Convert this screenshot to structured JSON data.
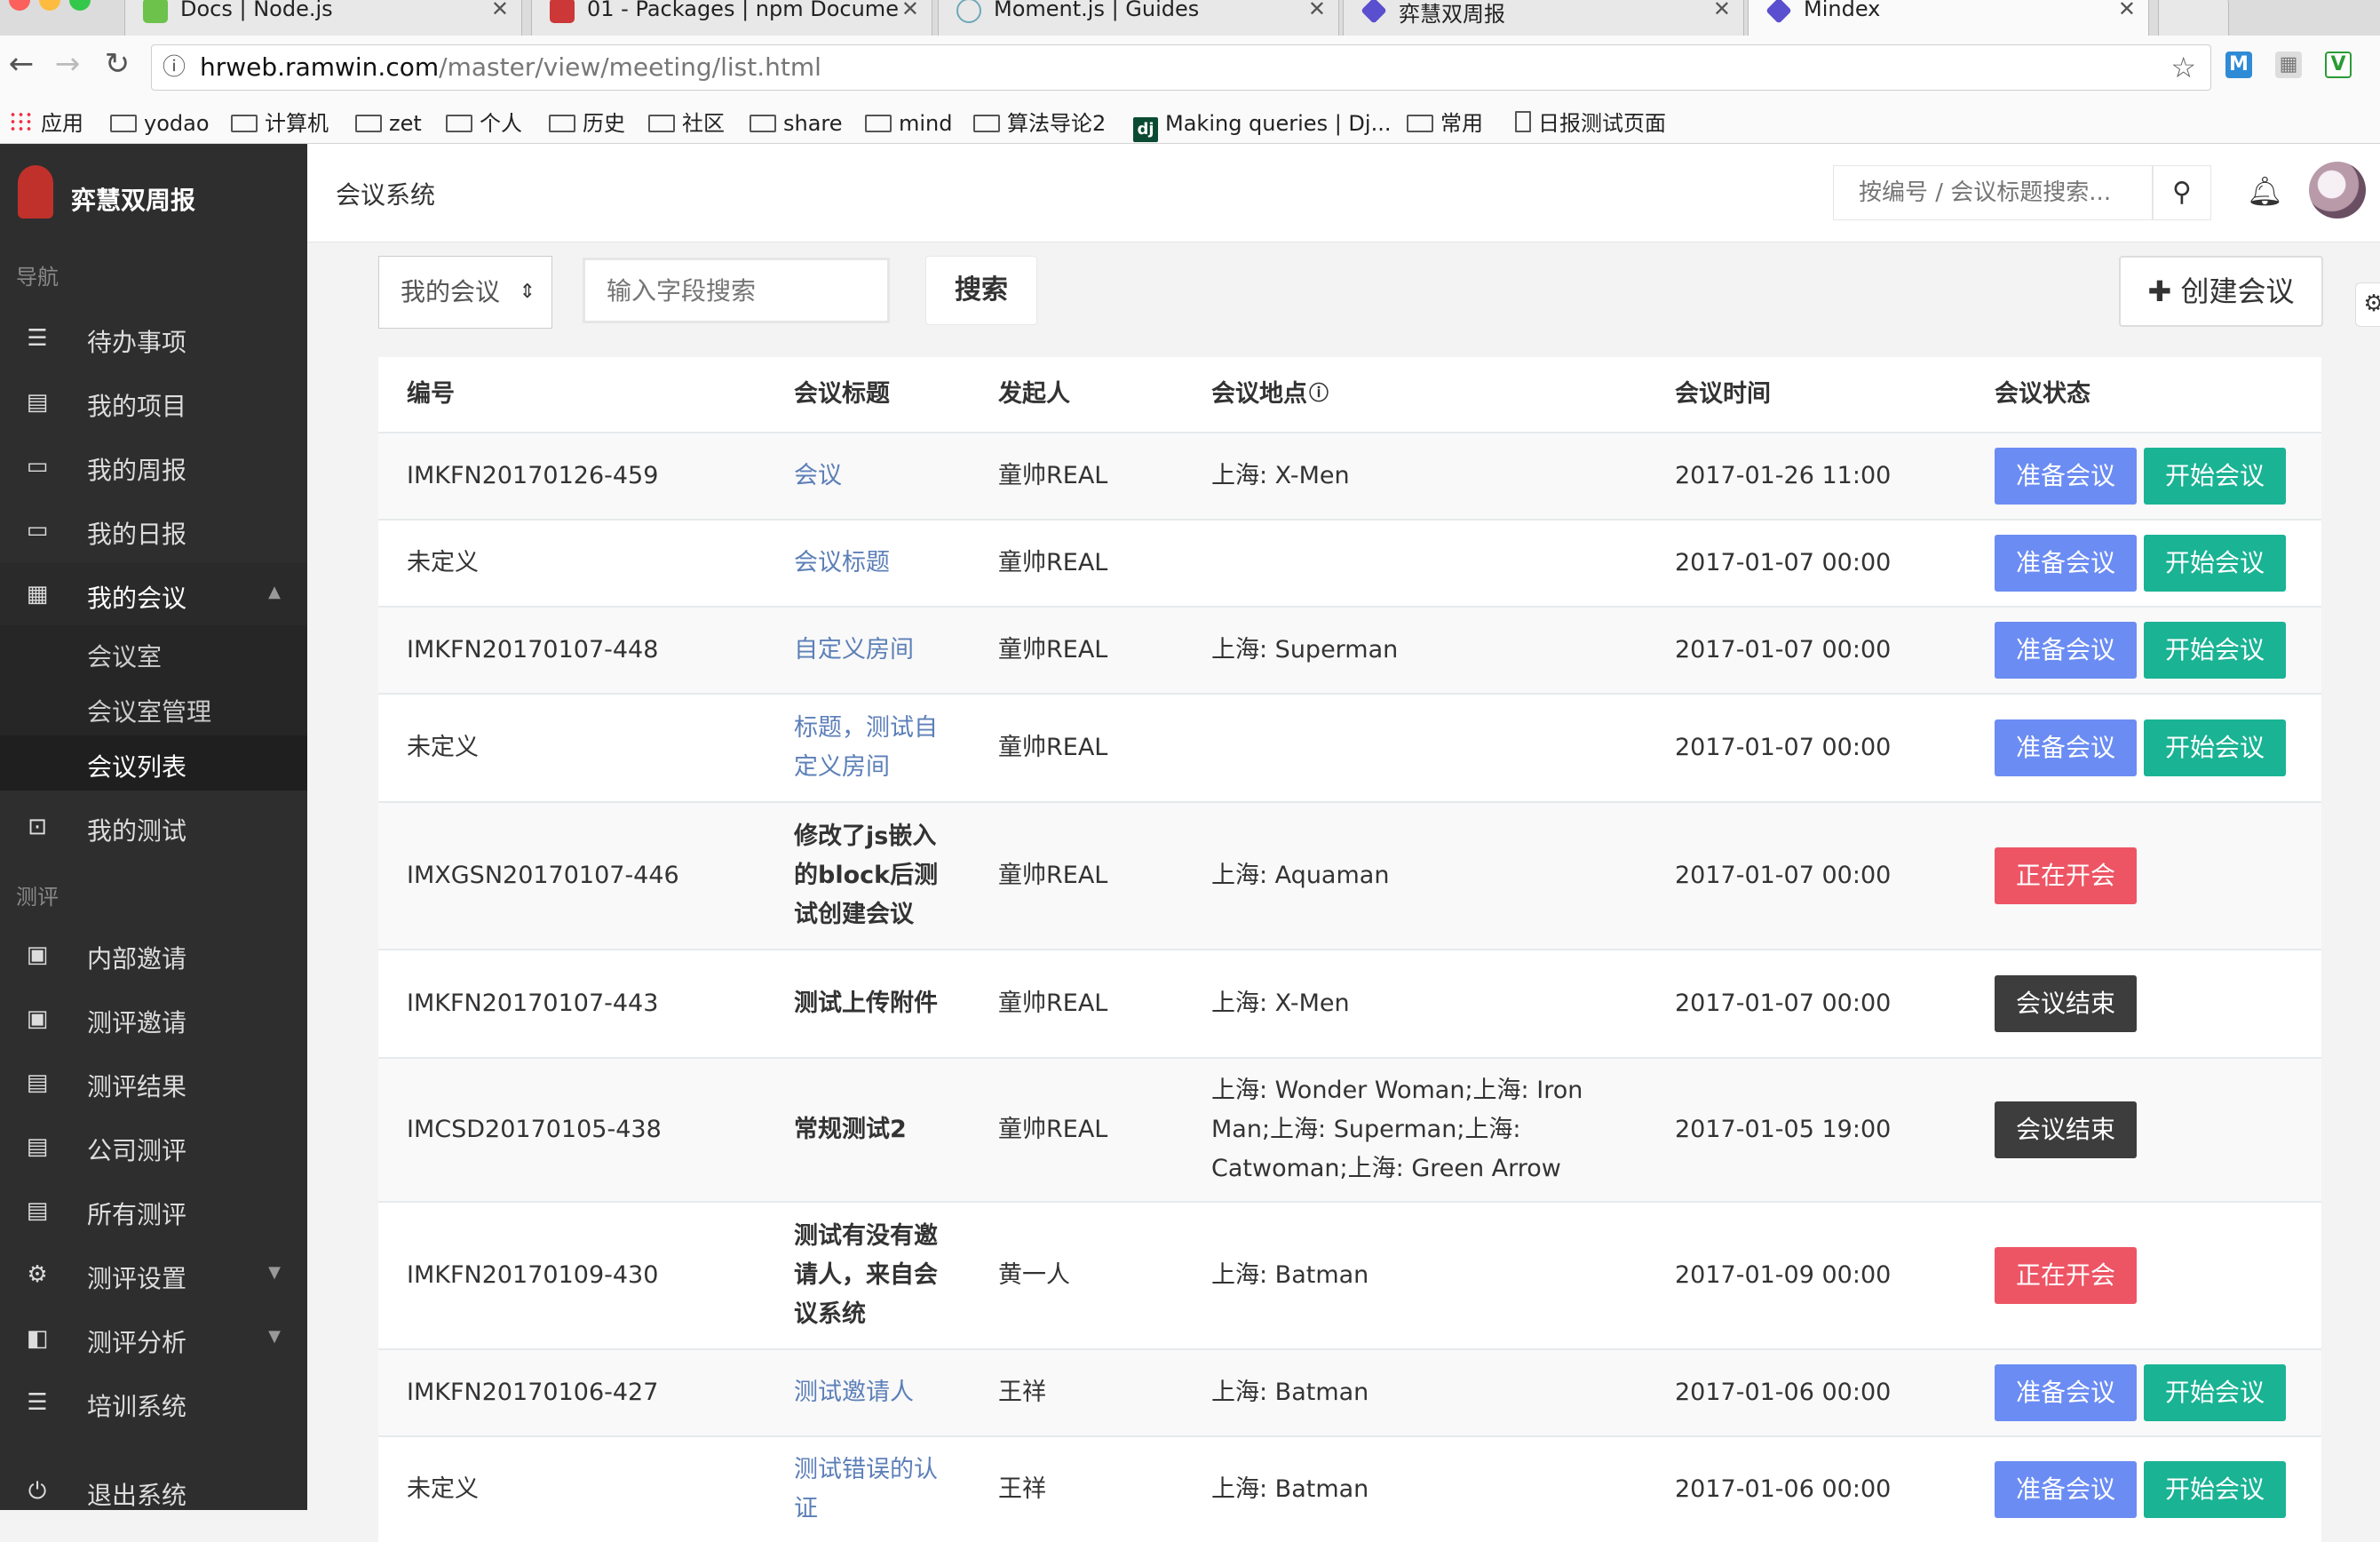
{
  "browser": {
    "tabs": [
      {
        "title": "Docs | Node.js",
        "icon": "nodejs-icon"
      },
      {
        "title": "01 - Packages | npm Documen",
        "icon": "npm-icon"
      },
      {
        "title": "Moment.js | Guides",
        "icon": "clock-icon"
      },
      {
        "title": "弈慧双周报",
        "icon": "diamond-icon"
      },
      {
        "title": "Mindex",
        "icon": "diamond-icon"
      }
    ],
    "url_host": "hrweb.ramwin.com",
    "url_path": "/master/view/meeting/list.html",
    "bookmarks": [
      "应用",
      "yodao",
      "计算机",
      "zet",
      "个人",
      "历史",
      "社区",
      "share",
      "mind",
      "算法导论2",
      "Making queries | Dj...",
      "常用",
      "日报测试页面"
    ]
  },
  "sidebar": {
    "brand": "弈慧双周报",
    "section_nav": "导航",
    "nav_items": [
      {
        "label": "待办事项",
        "icon": "list-icon"
      },
      {
        "label": "我的项目",
        "icon": "document-icon"
      },
      {
        "label": "我的周报",
        "icon": "folder-icon"
      },
      {
        "label": "我的日报",
        "icon": "folder-icon"
      },
      {
        "label": "我的会议",
        "icon": "calendar-icon"
      }
    ],
    "sub_items": [
      "会议室",
      "会议室管理",
      "会议列表"
    ],
    "test_item": "我的测试",
    "section_eval": "测评",
    "eval_items": [
      {
        "label": "内部邀请",
        "icon": "user-card-icon"
      },
      {
        "label": "测评邀请",
        "icon": "user-card-icon"
      },
      {
        "label": "测评结果",
        "icon": "clipboard-icon"
      },
      {
        "label": "公司测评",
        "icon": "clipboard-icon"
      },
      {
        "label": "所有测评",
        "icon": "clipboard-icon"
      },
      {
        "label": "测评设置",
        "icon": "gear-icon"
      },
      {
        "label": "测评分析",
        "icon": "chart-icon"
      },
      {
        "label": "培训系统",
        "icon": "list-icon"
      },
      {
        "label": "退出系统",
        "icon": "power-icon"
      }
    ]
  },
  "header": {
    "system_title": "会议系统",
    "search_placeholder": "按编号 / 会议标题搜索..."
  },
  "filters": {
    "scope_value": "我的会议",
    "field_placeholder": "输入字段搜索",
    "search_label": "搜索",
    "create_label": "✚ 创建会议"
  },
  "table": {
    "columns": [
      "编号",
      "会议标题",
      "发起人",
      "会议地点",
      "会议时间",
      "会议状态"
    ],
    "rows": [
      {
        "id": "IMKFN20170126-459",
        "title": "会议",
        "title_link": true,
        "host": "童帅REAL",
        "place": "上海: X-Men",
        "time": "2017-01-26 11:00",
        "status": [
          "准备会议",
          "开始会议"
        ]
      },
      {
        "id": "未定义",
        "title": "会议标题",
        "title_link": true,
        "host": "童帅REAL",
        "place": "",
        "time": "2017-01-07 00:00",
        "status": [
          "准备会议",
          "开始会议"
        ]
      },
      {
        "id": "IMKFN20170107-448",
        "title": "自定义房间",
        "title_link": true,
        "host": "童帅REAL",
        "place": "上海: Superman",
        "time": "2017-01-07 00:00",
        "status": [
          "准备会议",
          "开始会议"
        ]
      },
      {
        "id": "未定义",
        "title": "标题，测试自定义房间",
        "title_link": true,
        "host": "童帅REAL",
        "place": "",
        "time": "2017-01-07 00:00",
        "status": [
          "准备会议",
          "开始会议"
        ]
      },
      {
        "id": "IMXGSN20170107-446",
        "title": "修改了js嵌入的block后测试创建会议",
        "title_link": false,
        "host": "童帅REAL",
        "place": "上海: Aquaman",
        "time": "2017-01-07 00:00",
        "status": [
          "正在开会"
        ]
      },
      {
        "id": "IMKFN20170107-443",
        "title": "测试上传附件",
        "title_link": false,
        "host": "童帅REAL",
        "place": "上海: X-Men",
        "time": "2017-01-07 00:00",
        "status": [
          "会议结束"
        ]
      },
      {
        "id": "IMCSD20170105-438",
        "title": "常规测试2",
        "title_link": false,
        "host": "童帅REAL",
        "place": "上海: Wonder Woman;上海: Iron Man;上海: Superman;上海: Catwoman;上海: Green Arrow",
        "time": "2017-01-05 19:00",
        "status": [
          "会议结束"
        ]
      },
      {
        "id": "IMKFN20170109-430",
        "title": "测试有没有邀请人，来自会议系统",
        "title_link": false,
        "host": "黄一人",
        "place": "上海: Batman",
        "time": "2017-01-09 00:00",
        "status": [
          "正在开会"
        ]
      },
      {
        "id": "IMKFN20170106-427",
        "title": "测试邀请人",
        "title_link": true,
        "host": "王祥",
        "place": "上海: Batman",
        "time": "2017-01-06 00:00",
        "status": [
          "准备会议",
          "开始会议"
        ]
      },
      {
        "id": "未定义",
        "title": "测试错误的认证",
        "title_link": true,
        "host": "王祥",
        "place": "上海: Batman",
        "time": "2017-01-06 00:00",
        "status": [
          "准备会议",
          "开始会议"
        ]
      }
    ]
  },
  "colors": {
    "prepare": "#6b8cf3",
    "start": "#1ab394",
    "live": "#ed5565",
    "ended": "#3d3d3d",
    "link": "#5c7fb8",
    "sidebar_bg": "#2e2e2e"
  }
}
